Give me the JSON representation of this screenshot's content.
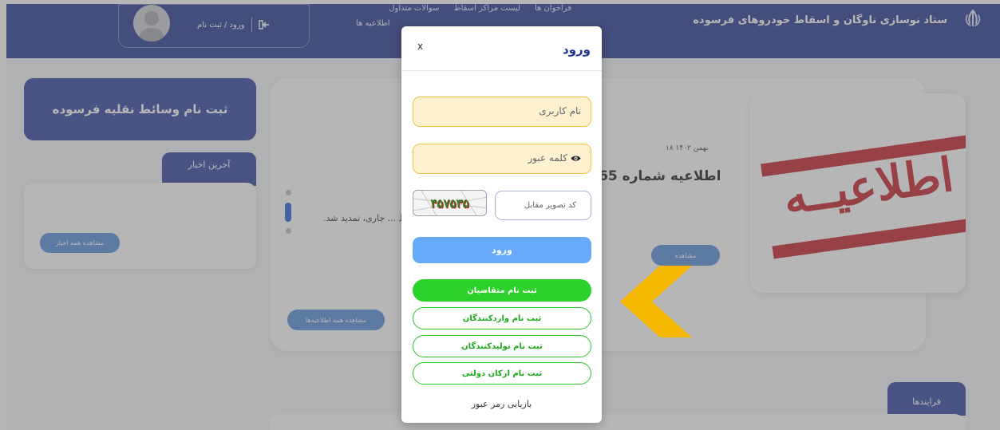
{
  "header": {
    "brand_title": "ستاد نوسازی ناوگان و اسقاط خودروهای فرسوده",
    "nav": [
      "فراخوان ها",
      "لیست مراکز اسقاط",
      "سوالات متداول"
    ],
    "nav_second_row": "اطلاعیه ها",
    "login_link": "ورود / ثبت نام"
  },
  "sidebar": {
    "register_vehicles": "ثبت نام وسائط نقلیه فرسوده",
    "news_tab": "آخرین اخبار",
    "news_all_button": "مشاهده همه اخبار"
  },
  "announcement": {
    "date": "۱۸ بهمن ۱۴۰۲",
    "title": "اطلاعیه شماره 65",
    "body": "مهلت انتقال گواهی اسقاط ... جاری، تمدید شد.",
    "more_button": "مشاهده",
    "all_button": "مشاهده همه اطلاعیه‌ها",
    "image_text": "اطلاعیــه"
  },
  "process_tab": "فرایندها",
  "modal": {
    "title": "ورود",
    "close": "x",
    "username_placeholder": "نام کاربری",
    "password_placeholder": "کلمه عبور",
    "captcha_text": "۴۵۷۵۳۵",
    "captcha_placeholder": "کد تصویر مقابل",
    "login_button": "ورود",
    "register_applicants": "ثبت نام متقاضیان",
    "register_importers": "ثبت نام واردکنندگان",
    "register_producers": "ثبت نام تولیدکنندگان",
    "register_government": "ثبت نام ارکان دولتی",
    "forgot_password": "بازیابی رمز عبور"
  },
  "colors": {
    "header_bg": "#1b2e8a",
    "primary_button": "#66aaf9",
    "green": "#2cd12c",
    "input_bg": "#fdf1d0",
    "input_border": "#f0c14b",
    "chevron": "#f6b700",
    "stamp_red": "#c0121d"
  }
}
